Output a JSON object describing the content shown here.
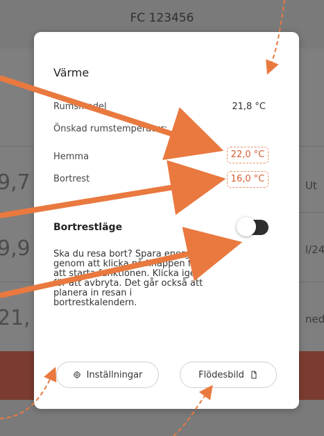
{
  "background": {
    "header_id": "FC 123456",
    "rows": [
      {
        "num": "9,7",
        "right": "Ut"
      },
      {
        "num": "9,9",
        "right": "l/24"
      },
      {
        "num": "21,",
        "right": "ned"
      }
    ]
  },
  "modal": {
    "title": "Värme",
    "rows": [
      {
        "label": "Rumsmedel",
        "value": "21,8 °C"
      },
      {
        "label": "Önskad rumstemperatur:",
        "value": ""
      },
      {
        "label": "Hemma",
        "value": "22,0 °C"
      },
      {
        "label": "Bortrest",
        "value": "16,0 °C"
      }
    ],
    "away_mode": {
      "label": "Bortrestläge",
      "description": "Ska du resa bort? Spara energi genom att klicka på knappen för att starta funktionen. Klicka igen för att avbryta. Det går också att planera in resan i bortrestkalendern."
    },
    "buttons": {
      "settings": "Inställningar",
      "flow": "Flödesbild"
    }
  },
  "colors": {
    "accent": "#e9793f",
    "overlay": "#7f7f7f",
    "danger_band": "#7b3c2f"
  }
}
